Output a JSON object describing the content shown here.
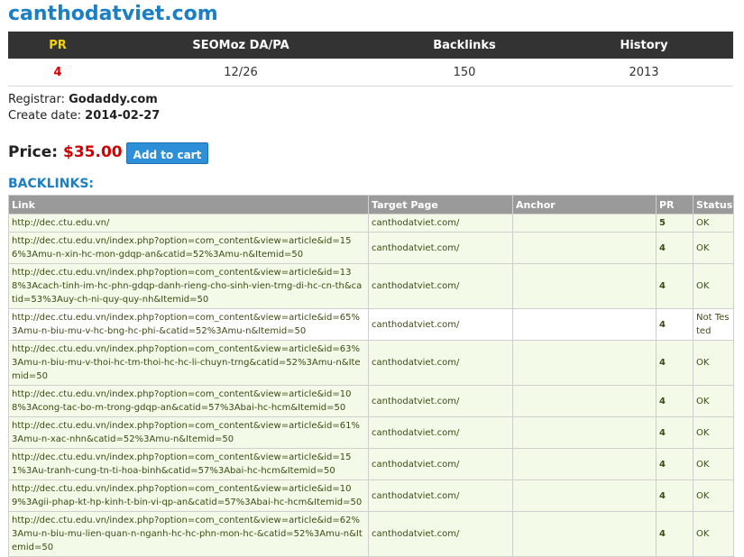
{
  "site": {
    "title": "canthodatviet.com"
  },
  "summary": {
    "headers": [
      "PR",
      "SEOMoz DA/PA",
      "Backlinks",
      "History"
    ],
    "values": [
      "4",
      "12/26",
      "150",
      "2013"
    ]
  },
  "info": {
    "registrar_label": "Registrar:",
    "registrar_value": "Godaddy.com",
    "create_label": "Create date:",
    "create_value": "2014-02-27"
  },
  "price": {
    "label": "Price:",
    "amount": "$35.00"
  },
  "cart": {
    "label": "Add to cart"
  },
  "backlinks": {
    "heading": "BACKLINKS:",
    "headers": [
      "Link",
      "Target Page",
      "Anchor",
      "PR",
      "Status"
    ],
    "rows": [
      {
        "link": "http://dec.ctu.edu.vn/",
        "target": "canthodatviet.com/",
        "anchor": "",
        "pr": "5",
        "status": "OK"
      },
      {
        "link": "http://dec.ctu.edu.vn/index.php?option=com_content&view=article&id=156%3Amu-n-xin-hc-mon-gdqp-an&catid=52%3Amu-n&Itemid=50",
        "target": "canthodatviet.com/",
        "anchor": "",
        "pr": "4",
        "status": "OK"
      },
      {
        "link": "http://dec.ctu.edu.vn/index.php?option=com_content&view=article&id=138%3Acach-tinh-im-hc-phn-gdqp-danh-rieng-cho-sinh-vien-trng-di-hc-cn-th&catid=53%3Auy-ch-ni-quy-quy-nh&Itemid=50",
        "target": "canthodatviet.com/",
        "anchor": "",
        "pr": "4",
        "status": "OK"
      },
      {
        "link": "http://dec.ctu.edu.vn/index.php?option=com_content&view=article&id=65%3Amu-n-biu-mu-v-hc-bng-hc-phi-&catid=52%3Amu-n&Itemid=50",
        "target": "canthodatviet.com/",
        "anchor": "",
        "pr": "4",
        "status": "Not Tested"
      },
      {
        "link": "http://dec.ctu.edu.vn/index.php?option=com_content&view=article&id=63%3Amu-n-biu-mu-v-thoi-hc-tm-thoi-hc-hc-li-chuyn-trng&catid=52%3Amu-n&Itemid=50",
        "target": "canthodatviet.com/",
        "anchor": "",
        "pr": "4",
        "status": "OK"
      },
      {
        "link": "http://dec.ctu.edu.vn/index.php?option=com_content&view=article&id=108%3Acong-tac-bo-m-trong-gdqp-an&catid=57%3Abai-hc-hcm&Itemid=50",
        "target": "canthodatviet.com/",
        "anchor": "",
        "pr": "4",
        "status": "OK"
      },
      {
        "link": "http://dec.ctu.edu.vn/index.php?option=com_content&view=article&id=61%3Amu-n-xac-nhn&catid=52%3Amu-n&Itemid=50",
        "target": "canthodatviet.com/",
        "anchor": "",
        "pr": "4",
        "status": "OK"
      },
      {
        "link": "http://dec.ctu.edu.vn/index.php?option=com_content&view=article&id=151%3Au-tranh-cung-tn-ti-hoa-binh&catid=57%3Abai-hc-hcm&Itemid=50",
        "target": "canthodatviet.com/",
        "anchor": "",
        "pr": "4",
        "status": "OK"
      },
      {
        "link": "http://dec.ctu.edu.vn/index.php?option=com_content&view=article&id=109%3Agii-phap-kt-hp-kinh-t-bin-vi-qp-an&catid=57%3Abai-hc-hcm&Itemid=50",
        "target": "canthodatviet.com/",
        "anchor": "",
        "pr": "4",
        "status": "OK"
      },
      {
        "link": "http://dec.ctu.edu.vn/index.php?option=com_content&view=article&id=62%3Amu-n-biu-mu-lien-quan-n-nganh-hc-hc-phn-mon-hc-&catid=52%3Amu-n&Itemid=50",
        "target": "canthodatviet.com/",
        "anchor": "",
        "pr": "4",
        "status": "OK"
      }
    ]
  }
}
